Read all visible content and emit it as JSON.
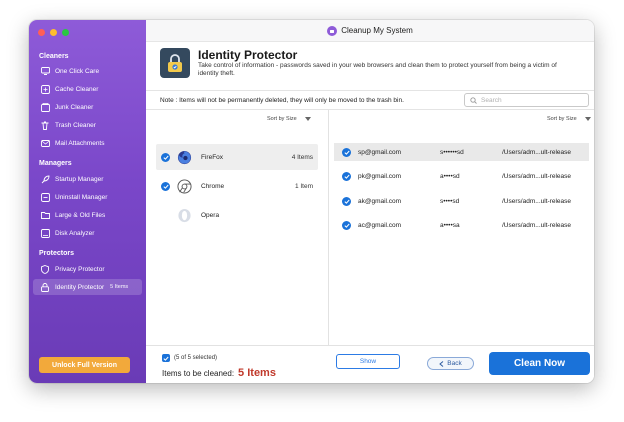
{
  "app": {
    "title": "Cleanup My System"
  },
  "sidebar": {
    "sections": [
      {
        "title": "Cleaners",
        "items": [
          {
            "label": "One Click Care",
            "icon": "monitor-icon"
          },
          {
            "label": "Cache Cleaner",
            "icon": "cache-icon"
          },
          {
            "label": "Junk Cleaner",
            "icon": "junk-icon"
          },
          {
            "label": "Trash Cleaner",
            "icon": "trash-icon"
          },
          {
            "label": "Mail Attachments",
            "icon": "mail-icon"
          }
        ]
      },
      {
        "title": "Managers",
        "items": [
          {
            "label": "Startup Manager",
            "icon": "rocket-icon"
          },
          {
            "label": "Uninstall Manager",
            "icon": "uninstall-icon"
          },
          {
            "label": "Large & Old Files",
            "icon": "folder-icon"
          },
          {
            "label": "Disk Analyzer",
            "icon": "disk-icon"
          }
        ]
      },
      {
        "title": "Protectors",
        "items": [
          {
            "label": "Privacy Protector",
            "icon": "shield-icon"
          },
          {
            "label": "Identity Protector",
            "icon": "lock-icon",
            "count": "5 Items",
            "active": true
          }
        ]
      }
    ],
    "unlock_label": "Unlock Full Version"
  },
  "header": {
    "title": "Identity Protector",
    "description": "Take control of information - passwords saved in your web browsers and clean them to protect yourself from being a victim of identity theft."
  },
  "note": "Note : Items will not be permanently deleted, they will only be moved to the trash bin.",
  "search": {
    "placeholder": "Search"
  },
  "browsers_pane": {
    "sort_label": "Sort by Size",
    "browsers": [
      {
        "name": "FireFox",
        "count": "4 Items",
        "checked": true,
        "selected": true
      },
      {
        "name": "Chrome",
        "count": "1 Item",
        "checked": true,
        "selected": false
      },
      {
        "name": "Opera",
        "count": "",
        "checked": false,
        "selected": false
      }
    ]
  },
  "entries_pane": {
    "sort_label": "Sort by Size",
    "entries": [
      {
        "email": "sp@gmail.com",
        "password": "s••••••sd",
        "path": "/Users/adm...ult-release",
        "selected": true
      },
      {
        "email": "pk@gmail.com",
        "password": "a••••sd",
        "path": "/Users/adm...ult-release",
        "selected": false
      },
      {
        "email": "ak@gmail.com",
        "password": "s••••sd",
        "path": "/Users/adm...ult-release",
        "selected": false
      },
      {
        "email": "ac@gmail.com",
        "password": "a••••sa",
        "path": "/Users/adm...ult-release",
        "selected": false
      }
    ]
  },
  "footer": {
    "selection_summary": "(5 of 5 selected)",
    "items_label": "Items to be cleaned:",
    "items_value": "5 Items",
    "show_label": "Show",
    "back_label": "Back",
    "clean_label": "Clean Now"
  },
  "colors": {
    "accent": "#1a72d9",
    "sidebar": "#7a47c9",
    "unlock": "#f2a93b",
    "count_red": "#c0392b"
  }
}
